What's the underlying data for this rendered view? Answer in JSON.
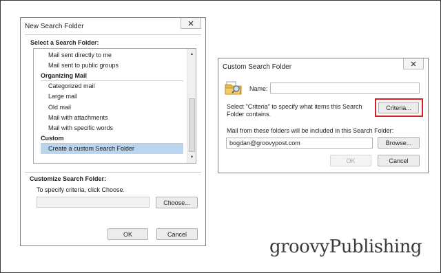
{
  "new_search_folder": {
    "title": "New Search Folder",
    "select_heading": "Select a Search Folder:",
    "items": [
      {
        "label": "Mail sent directly to me",
        "kind": "entry"
      },
      {
        "label": "Mail sent to public groups",
        "kind": "entry"
      },
      {
        "label": "Organizing Mail",
        "kind": "header"
      },
      {
        "label": "Categorized mail",
        "kind": "entry"
      },
      {
        "label": "Large mail",
        "kind": "entry"
      },
      {
        "label": "Old mail",
        "kind": "entry"
      },
      {
        "label": "Mail with attachments",
        "kind": "entry"
      },
      {
        "label": "Mail with specific words",
        "kind": "entry"
      },
      {
        "label": "Custom",
        "kind": "header"
      },
      {
        "label": "Create a custom Search Folder",
        "kind": "selected"
      }
    ],
    "customize_heading": "Customize Search Folder:",
    "customize_hint": "To specify criteria, click Choose.",
    "criteria_value": "",
    "choose_button": "Choose...",
    "ok_button": "OK",
    "cancel_button": "Cancel"
  },
  "custom_search_folder": {
    "title": "Custom Search Folder",
    "name_label": "Name:",
    "name_value": "",
    "criteria_text": "Select \"Criteria\" to specify what items this Search Folder contains.",
    "criteria_button": "Criteria...",
    "folders_text": "Mail from these folders will be included in this Search Folder:",
    "folder_value": "bogdan@groovypost.com",
    "browse_button": "Browse...",
    "ok_button": "OK",
    "cancel_button": "Cancel"
  },
  "watermark": "groovyPublishing",
  "colors": {
    "highlight": "#d81f26",
    "selection": "#b9d5f0",
    "close_hover": "#c42b1c"
  }
}
